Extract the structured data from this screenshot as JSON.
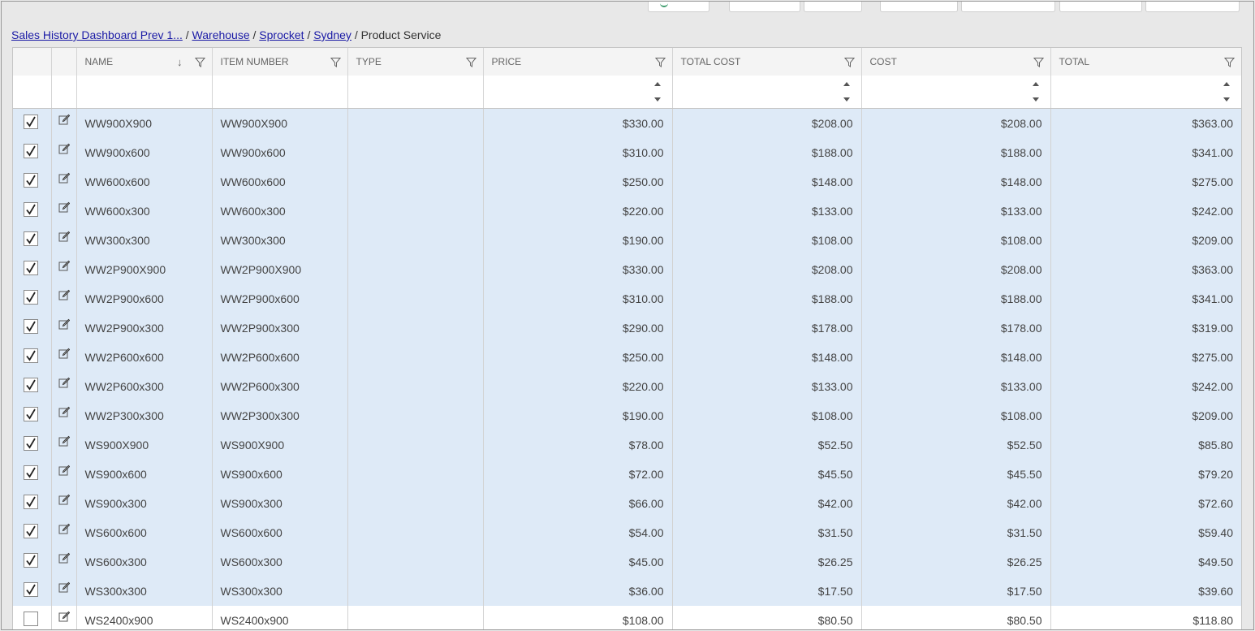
{
  "breadcrumb": {
    "links": [
      "Sales History Dashboard Prev 1...",
      "Warehouse",
      "Sprocket",
      "Sydney"
    ],
    "separator": "/",
    "current": "Product Service"
  },
  "columns": {
    "name": "NAME",
    "item_number": "ITEM NUMBER",
    "type": "TYPE",
    "price": "PRICE",
    "total_cost": "TOTAL COST",
    "cost": "COST",
    "total": "TOTAL"
  },
  "rows": [
    {
      "checked": true,
      "name": "WW900X900",
      "item_number": "WW900X900",
      "type": "",
      "price": "$330.00",
      "total_cost": "$208.00",
      "cost": "$208.00",
      "total": "$363.00"
    },
    {
      "checked": true,
      "name": "WW900x600",
      "item_number": "WW900x600",
      "type": "",
      "price": "$310.00",
      "total_cost": "$188.00",
      "cost": "$188.00",
      "total": "$341.00"
    },
    {
      "checked": true,
      "name": "WW600x600",
      "item_number": "WW600x600",
      "type": "",
      "price": "$250.00",
      "total_cost": "$148.00",
      "cost": "$148.00",
      "total": "$275.00"
    },
    {
      "checked": true,
      "name": "WW600x300",
      "item_number": "WW600x300",
      "type": "",
      "price": "$220.00",
      "total_cost": "$133.00",
      "cost": "$133.00",
      "total": "$242.00"
    },
    {
      "checked": true,
      "name": "WW300x300",
      "item_number": "WW300x300",
      "type": "",
      "price": "$190.00",
      "total_cost": "$108.00",
      "cost": "$108.00",
      "total": "$209.00"
    },
    {
      "checked": true,
      "name": "WW2P900X900",
      "item_number": "WW2P900X900",
      "type": "",
      "price": "$330.00",
      "total_cost": "$208.00",
      "cost": "$208.00",
      "total": "$363.00"
    },
    {
      "checked": true,
      "name": "WW2P900x600",
      "item_number": "WW2P900x600",
      "type": "",
      "price": "$310.00",
      "total_cost": "$188.00",
      "cost": "$188.00",
      "total": "$341.00"
    },
    {
      "checked": true,
      "name": "WW2P900x300",
      "item_number": "WW2P900x300",
      "type": "",
      "price": "$290.00",
      "total_cost": "$178.00",
      "cost": "$178.00",
      "total": "$319.00"
    },
    {
      "checked": true,
      "name": "WW2P600x600",
      "item_number": "WW2P600x600",
      "type": "",
      "price": "$250.00",
      "total_cost": "$148.00",
      "cost": "$148.00",
      "total": "$275.00"
    },
    {
      "checked": true,
      "name": "WW2P600x300",
      "item_number": "WW2P600x300",
      "type": "",
      "price": "$220.00",
      "total_cost": "$133.00",
      "cost": "$133.00",
      "total": "$242.00"
    },
    {
      "checked": true,
      "name": "WW2P300x300",
      "item_number": "WW2P300x300",
      "type": "",
      "price": "$190.00",
      "total_cost": "$108.00",
      "cost": "$108.00",
      "total": "$209.00"
    },
    {
      "checked": true,
      "name": "WS900X900",
      "item_number": "WS900X900",
      "type": "",
      "price": "$78.00",
      "total_cost": "$52.50",
      "cost": "$52.50",
      "total": "$85.80"
    },
    {
      "checked": true,
      "name": "WS900x600",
      "item_number": "WS900x600",
      "type": "",
      "price": "$72.00",
      "total_cost": "$45.50",
      "cost": "$45.50",
      "total": "$79.20"
    },
    {
      "checked": true,
      "name": "WS900x300",
      "item_number": "WS900x300",
      "type": "",
      "price": "$66.00",
      "total_cost": "$42.00",
      "cost": "$42.00",
      "total": "$72.60"
    },
    {
      "checked": true,
      "name": "WS600x600",
      "item_number": "WS600x600",
      "type": "",
      "price": "$54.00",
      "total_cost": "$31.50",
      "cost": "$31.50",
      "total": "$59.40"
    },
    {
      "checked": true,
      "name": "WS600x300",
      "item_number": "WS600x300",
      "type": "",
      "price": "$45.00",
      "total_cost": "$26.25",
      "cost": "$26.25",
      "total": "$49.50"
    },
    {
      "checked": true,
      "name": "WS300x300",
      "item_number": "WS300x300",
      "type": "",
      "price": "$36.00",
      "total_cost": "$17.50",
      "cost": "$17.50",
      "total": "$39.60"
    },
    {
      "checked": false,
      "name": "WS2400x900",
      "item_number": "WS2400x900",
      "type": "",
      "price": "$108.00",
      "total_cost": "$80.50",
      "cost": "$80.50",
      "total": "$118.80"
    }
  ],
  "sort": {
    "column": "name",
    "icon": "sort-down-arrow-icon"
  },
  "icons": {
    "filter": "filter-icon",
    "edit": "edit-icon",
    "check": "checkmark-icon"
  },
  "colors": {
    "selected_row": "#deeaf7",
    "link": "#1a1aa6",
    "header_bg": "#f4f4f4"
  }
}
